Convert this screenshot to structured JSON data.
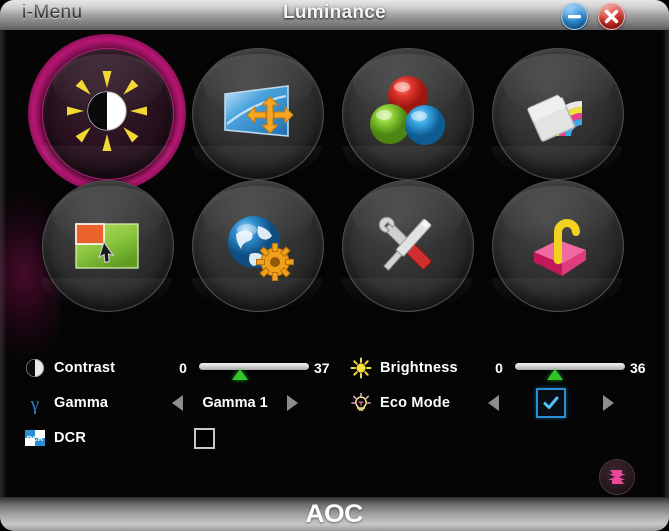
{
  "window": {
    "app_name": "i-Menu",
    "title": "Luminance",
    "minimize_label": "Minimize",
    "close_label": "Close"
  },
  "menu_grid": {
    "items": [
      {
        "id": "luminance",
        "icon": "sun-contrast-icon",
        "selected": true
      },
      {
        "id": "image-setup",
        "icon": "image-setup-icon",
        "selected": false
      },
      {
        "id": "color-setup",
        "icon": "rgb-spheres-icon",
        "selected": false
      },
      {
        "id": "picture-boost",
        "icon": "rainbow-card-icon",
        "selected": false
      },
      {
        "id": "osd-setup",
        "icon": "osd-cursor-icon",
        "selected": false
      },
      {
        "id": "language",
        "icon": "globe-gear-icon",
        "selected": false
      },
      {
        "id": "extra",
        "icon": "wrench-screwdriver-icon",
        "selected": false
      },
      {
        "id": "exit",
        "icon": "pink-box-hook-icon",
        "selected": false
      }
    ]
  },
  "controls": {
    "contrast": {
      "icon": "contrast-circle-icon",
      "label": "Contrast",
      "min": "0",
      "max": "37",
      "value": 37,
      "range_max": 100
    },
    "brightness": {
      "icon": "sun-icon",
      "label": "Brightness",
      "min": "0",
      "max": "36",
      "value": 36,
      "range_max": 100
    },
    "gamma": {
      "icon": "gamma-icon",
      "label": "Gamma",
      "value": "Gamma 1",
      "prev_label": "Previous",
      "next_label": "Next"
    },
    "eco_mode": {
      "icon": "eco-bulb-icon",
      "label": "Eco Mode",
      "checked": true,
      "prev_label": "Previous",
      "next_label": "Next"
    },
    "dcr": {
      "icon": "dcr-icon",
      "label": "DCR",
      "checked": false
    }
  },
  "reset": {
    "icon": "reset-arrows-icon",
    "label": "Reset"
  },
  "footer": {
    "brand": "AOC"
  },
  "colors": {
    "selection_glow": "#d61986",
    "slider_thumb": "#33c42a",
    "eco_accent": "#2b8fd4",
    "close_button": "#d7342b",
    "minimize_button": "#2f8fd8"
  }
}
